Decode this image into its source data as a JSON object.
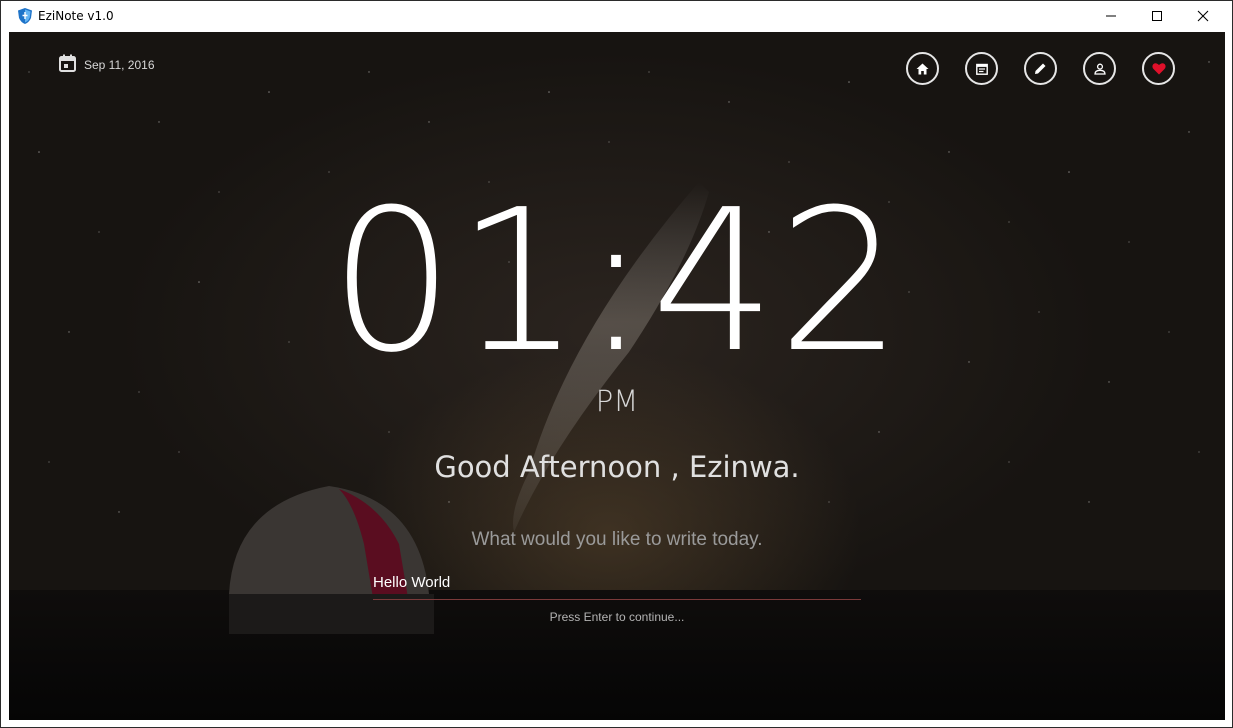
{
  "window": {
    "title": "EziNote v1.0",
    "minimize_icon": "minimize-icon",
    "maximize_icon": "maximize-icon",
    "close_icon": "close-icon"
  },
  "header": {
    "date": "Sep 11, 2016",
    "date_icon": "calendar-icon"
  },
  "nav": [
    {
      "name": "home",
      "icon": "home-icon"
    },
    {
      "name": "notes",
      "icon": "notes-icon"
    },
    {
      "name": "write",
      "icon": "pencil-icon"
    },
    {
      "name": "profile",
      "icon": "user-icon"
    },
    {
      "name": "favorites",
      "icon": "heart-icon",
      "color": "#e0102a"
    }
  ],
  "clock": {
    "time": "01:42",
    "ampm": "PM"
  },
  "greeting": "Good Afternoon , Ezinwa.",
  "prompt": "What would you like to write today.",
  "note_input": {
    "value": "Hello World"
  },
  "hint": "Press Enter to continue..."
}
